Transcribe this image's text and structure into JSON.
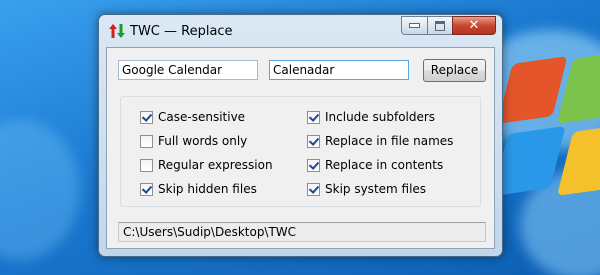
{
  "window": {
    "title": "TWC — Replace",
    "icon": "up-down-arrows-icon"
  },
  "form": {
    "search_value": "Google Calendar",
    "replace_value": "Calenadar",
    "replace_button": "Replace"
  },
  "options": [
    {
      "label": "Case-sensitive",
      "checked": true
    },
    {
      "label": "Full words only",
      "checked": false
    },
    {
      "label": "Regular expression",
      "checked": false
    },
    {
      "label": "Skip hidden files",
      "checked": true
    },
    {
      "label": "Include subfolders",
      "checked": true
    },
    {
      "label": "Replace in file names",
      "checked": true
    },
    {
      "label": "Replace in contents",
      "checked": true
    },
    {
      "label": "Skip system files",
      "checked": true
    }
  ],
  "status": {
    "path": "C:\\Users\\Sudip\\Desktop\\TWC"
  },
  "colors": {
    "desktop": "#1a78cf",
    "close_button": "#c8472f",
    "check_mark": "#1c4a8c"
  }
}
